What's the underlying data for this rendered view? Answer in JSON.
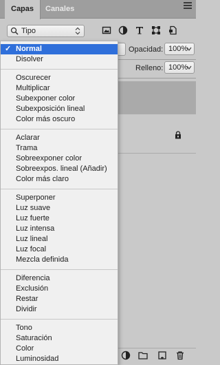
{
  "tabs": [
    {
      "label": "Capas",
      "active": true
    },
    {
      "label": "Canales",
      "active": false
    }
  ],
  "filter": {
    "kind_label": "Tipo",
    "icons": [
      "pixel-filter-icon",
      "adjustment-filter-icon",
      "type-filter-icon",
      "shape-filter-icon",
      "smart-object-filter-icon"
    ]
  },
  "properties": {
    "opacity_label": "Opacidad:",
    "opacity_value": "100%",
    "fill_label": "Relleno:",
    "fill_value": "100%"
  },
  "blend_menu": {
    "selected": "Normal",
    "groups": [
      [
        "Normal",
        "Disolver"
      ],
      [
        "Oscurecer",
        "Multiplicar",
        "Subexponer color",
        "Subexposición lineal",
        "Color más oscuro"
      ],
      [
        "Aclarar",
        "Trama",
        "Sobreexponer color",
        "Sobreexpos. lineal (Añadir)",
        "Color más claro"
      ],
      [
        "Superponer",
        "Luz suave",
        "Luz fuerte",
        "Luz intensa",
        "Luz lineal",
        "Luz focal",
        "Mezcla definida"
      ],
      [
        "Diferencia",
        "Exclusión",
        "Restar",
        "Dividir"
      ],
      [
        "Tono",
        "Saturación",
        "Color",
        "Luminosidad"
      ]
    ]
  },
  "colors": {
    "panel_bg": "#c9c9c9",
    "tabbar_bg": "#9e9e9e",
    "menu_bg": "#f0f0f0",
    "selection": "#2f6fda"
  }
}
